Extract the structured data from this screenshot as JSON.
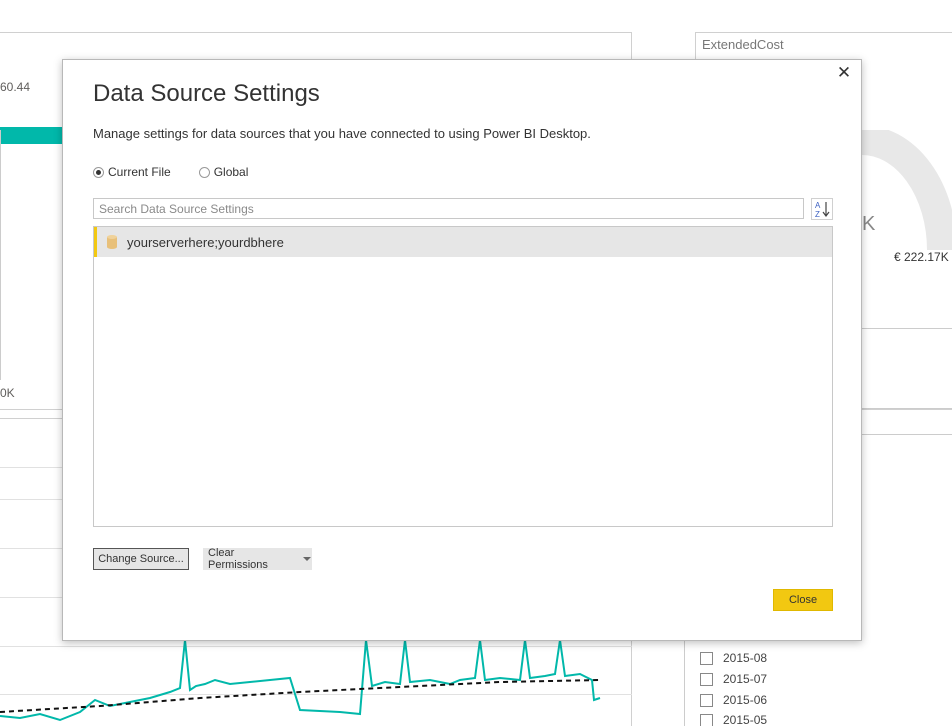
{
  "background": {
    "left_value_top": "60.44",
    "left_value_bottom": "0K",
    "right_card_title": "ExtendedCost",
    "gauge_value_partial": "K",
    "gauge_max": "€ 222.17K",
    "date_items": [
      "2015-08",
      "2015-07",
      "2015-06",
      "2015-05"
    ]
  },
  "dialog": {
    "title": "Data Source Settings",
    "description": "Manage settings for data sources that you have connected to using Power BI Desktop.",
    "close_icon": "close-icon",
    "scope_options": [
      {
        "label": "Current File",
        "selected": true
      },
      {
        "label": "Global",
        "selected": false
      }
    ],
    "search": {
      "placeholder": "Search Data Source Settings",
      "value": ""
    },
    "sort_icon": "sort-az-icon",
    "sources": [
      {
        "label": "yourserverhere;yourdbhere",
        "icon": "database-icon",
        "selected": true
      }
    ],
    "buttons": {
      "change_source": "Change Source...",
      "clear_permissions": "Clear Permissions",
      "close": "Close"
    }
  },
  "colors": {
    "accent_yellow": "#f2c811",
    "teal": "#01b8aa",
    "selected_row": "#e6e6e6"
  }
}
